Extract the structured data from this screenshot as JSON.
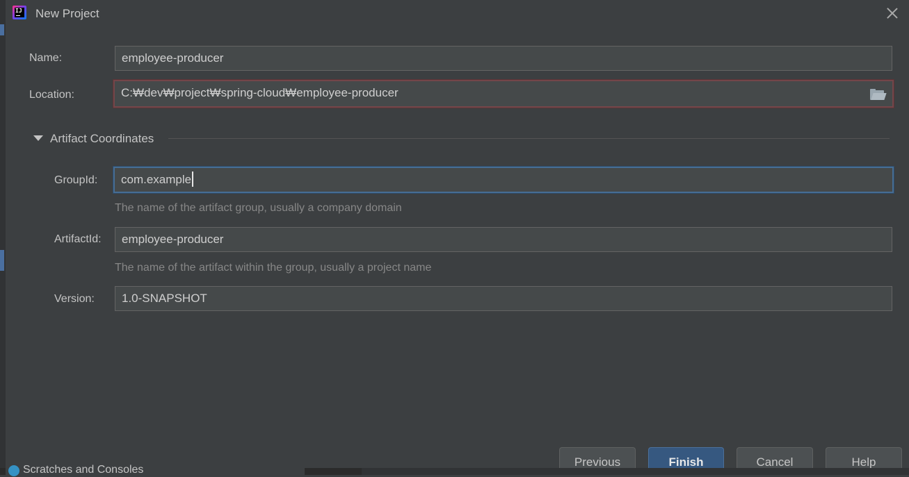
{
  "dialog": {
    "title": "New Project",
    "close_icon": "close-icon",
    "app_icon_text": "IJ"
  },
  "form": {
    "name": {
      "label": "Name:",
      "value": "employee-producer"
    },
    "location": {
      "label": "Location:",
      "value": "C:₩dev₩project₩spring-cloud₩employee-producer",
      "icon": "folder-open-icon",
      "state": "error"
    }
  },
  "artifact": {
    "section_title": "Artifact Coordinates",
    "expanded": true,
    "group_id": {
      "label": "GroupId:",
      "value": "com.example",
      "hint": "The name of the artifact group, usually a company domain",
      "state": "focused"
    },
    "artifact_id": {
      "label": "ArtifactId:",
      "value": "employee-producer",
      "hint": "The name of the artifact within the group, usually a project name"
    },
    "version": {
      "label": "Version:",
      "value": "1.0-SNAPSHOT"
    }
  },
  "buttons": {
    "previous": "Previous",
    "finish": "Finish",
    "cancel": "Cancel",
    "help": "Help"
  },
  "background_ide": {
    "project_tree_item": "Scratches and Consoles"
  },
  "colors": {
    "dialog_bg": "#3c3f41",
    "field_bg": "#45494a",
    "error_border": "#73464a",
    "focus_border": "#466d94",
    "primary_button": "#365880"
  }
}
